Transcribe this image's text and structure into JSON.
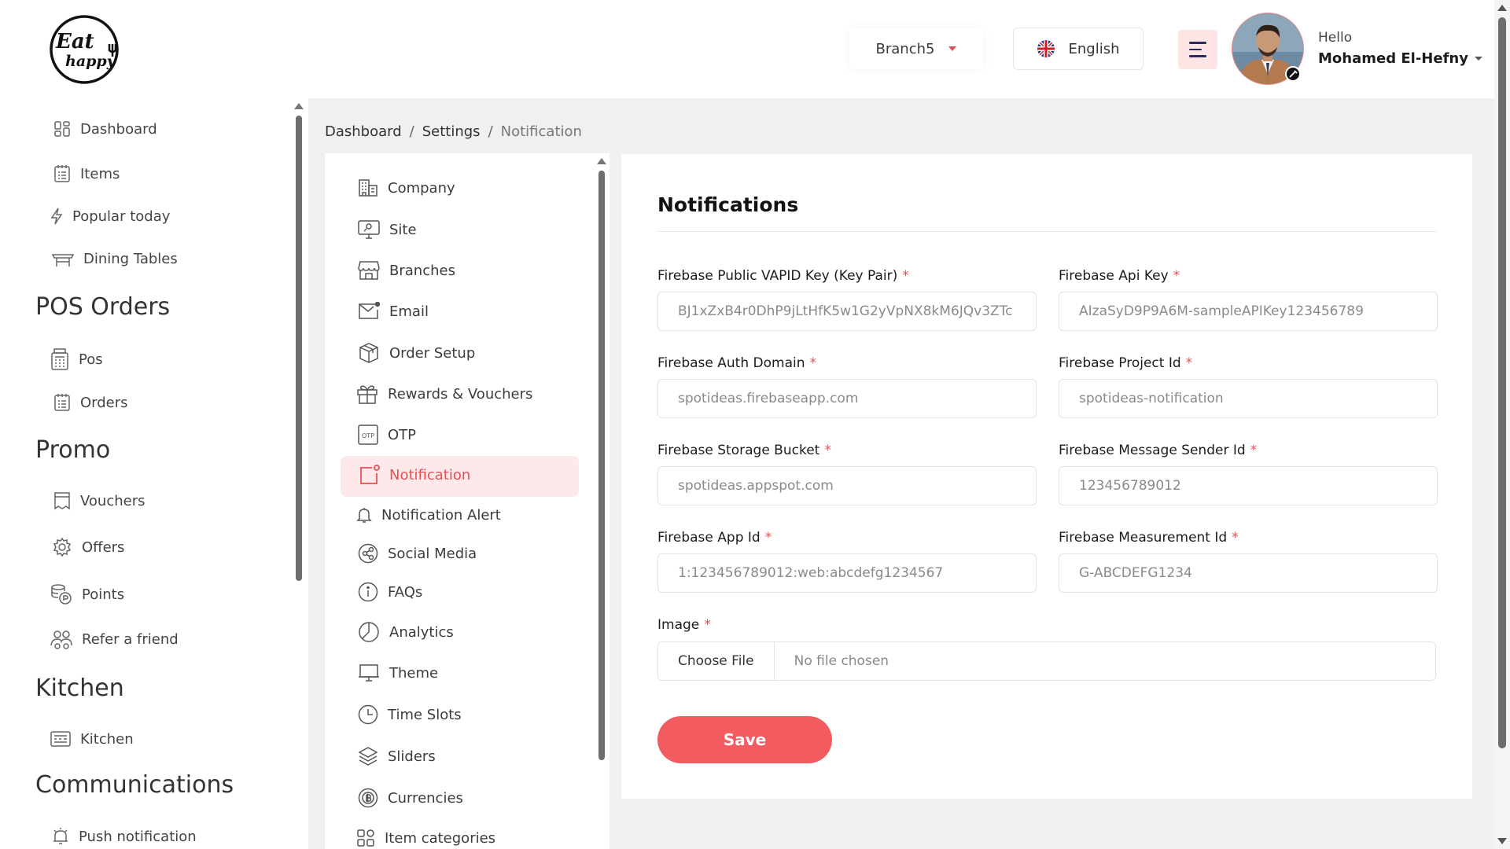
{
  "header": {
    "logo_line1": "Eat",
    "logo_line2": "happy",
    "branch": "Branch5",
    "language": "English",
    "greeting": "Hello",
    "user_name": "Mohamed El-Hefny"
  },
  "sidebar": {
    "items_top": [
      {
        "label": "Dashboard",
        "icon": "dashboard-icon"
      },
      {
        "label": "Items",
        "icon": "items-icon"
      },
      {
        "label": "Popular today",
        "icon": "lightning-icon"
      },
      {
        "label": "Dining Tables",
        "icon": "table-icon"
      }
    ],
    "section_pos": "POS Orders",
    "items_pos": [
      {
        "label": "Pos",
        "icon": "pos-icon"
      },
      {
        "label": "Orders",
        "icon": "orders-icon"
      }
    ],
    "section_promo": "Promo",
    "items_promo": [
      {
        "label": "Vouchers",
        "icon": "voucher-icon"
      },
      {
        "label": "Offers",
        "icon": "offers-icon"
      },
      {
        "label": "Points",
        "icon": "points-icon"
      },
      {
        "label": "Refer a friend",
        "icon": "refer-icon"
      }
    ],
    "section_kitchen": "Kitchen",
    "items_kitchen": [
      {
        "label": "Kitchen",
        "icon": "kitchen-icon"
      }
    ],
    "section_comm": "Communications",
    "items_comm": [
      {
        "label": "Push notification",
        "icon": "push-notification-icon"
      }
    ]
  },
  "breadcrumb": {
    "items": [
      "Dashboard",
      "Settings",
      "Notification"
    ],
    "separator": "/"
  },
  "settings_menu": [
    {
      "label": "Company",
      "icon": "company-icon"
    },
    {
      "label": "Site",
      "icon": "site-icon"
    },
    {
      "label": "Branches",
      "icon": "branches-icon"
    },
    {
      "label": "Email",
      "icon": "email-icon"
    },
    {
      "label": "Order Setup",
      "icon": "order-setup-icon"
    },
    {
      "label": "Rewards & Vouchers",
      "icon": "gift-icon"
    },
    {
      "label": "OTP",
      "icon": "otp-icon"
    },
    {
      "label": "Notification",
      "icon": "notification-icon",
      "active": true
    },
    {
      "label": "Notification Alert",
      "icon": "bell-icon"
    },
    {
      "label": "Social Media",
      "icon": "social-media-icon"
    },
    {
      "label": "FAQs",
      "icon": "info-icon"
    },
    {
      "label": "Analytics",
      "icon": "analytics-icon"
    },
    {
      "label": "Theme",
      "icon": "theme-icon"
    },
    {
      "label": "Time Slots",
      "icon": "clock-icon"
    },
    {
      "label": "Sliders",
      "icon": "layers-icon"
    },
    {
      "label": "Currencies",
      "icon": "currency-icon"
    },
    {
      "label": "Item categories",
      "icon": "categories-icon"
    }
  ],
  "form": {
    "title": "Notifications",
    "required_mark": "*",
    "fields": [
      {
        "label": "Firebase Public VAPID Key (Key Pair)",
        "value": "BJ1xZxB4r0DhP9jLtHfK5w1G2yVpNX8kM6JQv3ZTc"
      },
      {
        "label": "Firebase Api Key",
        "value": "AIzaSyD9P9A6M-sampleAPIKey123456789"
      },
      {
        "label": "Firebase Auth Domain",
        "value": "spotideas.firebaseapp.com"
      },
      {
        "label": "Firebase Project Id",
        "value": "spotideas-notification"
      },
      {
        "label": "Firebase Storage Bucket",
        "value": "spotideas.appspot.com"
      },
      {
        "label": "Firebase Message Sender Id",
        "value": "123456789012"
      },
      {
        "label": "Firebase App Id",
        "value": "1:123456789012:web:abcdefg1234567"
      },
      {
        "label": "Firebase Measurement Id",
        "value": "G-ABCDEFG1234"
      }
    ],
    "image_label": "Image",
    "file_button": "Choose File",
    "file_status": "No file chosen",
    "save_label": "Save"
  },
  "colors": {
    "accent": "#f25b5f",
    "accent_soft": "#fde9ea",
    "menu_bg": "#fde5e6"
  }
}
